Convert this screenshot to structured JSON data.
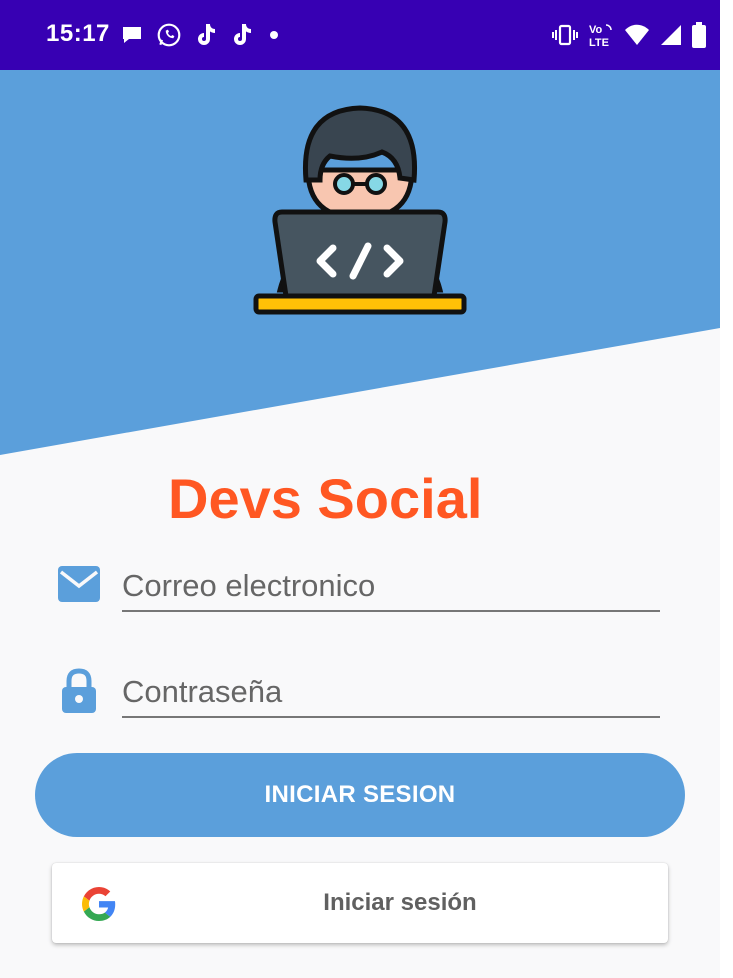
{
  "status_bar": {
    "time": "15:17",
    "left_icons": [
      "chat-bubble-icon",
      "whatsapp-icon",
      "tiktok-icon",
      "tiktok-icon",
      "dot-icon"
    ],
    "right_icons": [
      "vibrate-icon",
      "volte-icon",
      "wifi-icon",
      "signal-icon",
      "battery-icon"
    ],
    "volte_label": "Vo LTE"
  },
  "header": {
    "illustration": "developer-laptop-illustration",
    "code_symbol": "</>"
  },
  "app": {
    "title": "Devs Social"
  },
  "form": {
    "email": {
      "icon": "email-icon",
      "placeholder": "Correo electronico",
      "value": ""
    },
    "password": {
      "icon": "lock-icon",
      "placeholder": "Contraseña",
      "value": ""
    }
  },
  "buttons": {
    "login_label": "INICIAR SESION",
    "google_label": "Iniciar sesión",
    "google_icon": "google-icon"
  },
  "colors": {
    "status_bar": "#3700b3",
    "header_blue": "#5b9fdb",
    "title_orange": "#ff5722",
    "background": "#f9f9fa",
    "icon_blue": "#5b9fdb"
  }
}
